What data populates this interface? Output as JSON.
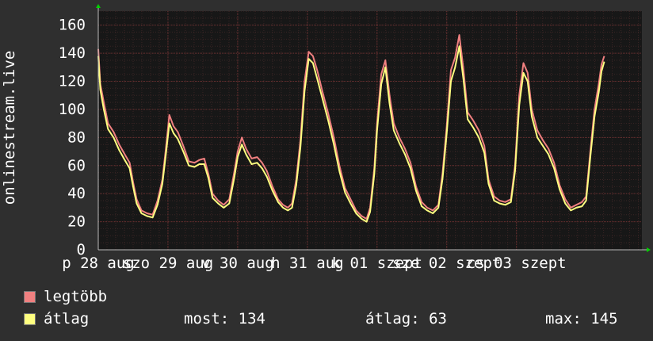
{
  "colors": {
    "background": "#2f2f2f",
    "plot_background": "#171717",
    "grid_minor": "#3a2525",
    "grid_major": "#6b3030",
    "max_series": "#f08080",
    "avg_series": "#ffff80",
    "axis_arrow": "#00d000",
    "text": "#ffffff"
  },
  "y_axis_title": "onlinestream.live",
  "legend": {
    "max_label": "legtöbb",
    "avg_label": "átlag"
  },
  "stats": {
    "current": "most: 134",
    "average": "átlag: 63",
    "maximum": "max: 145"
  },
  "chart_data": {
    "type": "line",
    "title": "",
    "ylabel": "onlinestream.live",
    "ylim": [
      0,
      170
    ],
    "yticks": [
      0,
      20,
      40,
      60,
      80,
      100,
      120,
      140,
      160
    ],
    "x": [
      "p 28 aug",
      "szo 29 aug",
      "v 30 aug",
      "h 31 aug",
      "k 01 szept",
      "sze 02 szept",
      "cs 03 szept"
    ],
    "xlim": [
      0,
      7.8
    ],
    "x_tick_labels": [
      {
        "at": 0,
        "label": "p 28 aug"
      },
      {
        "at": 1,
        "label": "szo 29 aug"
      },
      {
        "at": 2,
        "label": "v 30 aug"
      },
      {
        "at": 3,
        "label": "h 31 aug"
      },
      {
        "at": 4,
        "label": "k 01 szept"
      },
      {
        "at": 5,
        "label": "sze 02 szept"
      },
      {
        "at": 6,
        "label": "cs 03 szept"
      }
    ],
    "grid": true,
    "legend_position": "bottom-left",
    "series": [
      {
        "name": "legtöbb",
        "color": "#f08080",
        "points": [
          [
            0.0,
            143
          ],
          [
            0.03,
            118
          ],
          [
            0.08,
            105
          ],
          [
            0.14,
            90
          ],
          [
            0.22,
            84
          ],
          [
            0.3,
            75
          ],
          [
            0.38,
            68
          ],
          [
            0.45,
            62
          ],
          [
            0.5,
            48
          ],
          [
            0.55,
            36
          ],
          [
            0.62,
            28
          ],
          [
            0.7,
            26
          ],
          [
            0.78,
            25
          ],
          [
            0.85,
            35
          ],
          [
            0.92,
            50
          ],
          [
            0.97,
            72
          ],
          [
            1.02,
            96
          ],
          [
            1.08,
            88
          ],
          [
            1.14,
            84
          ],
          [
            1.22,
            74
          ],
          [
            1.3,
            63
          ],
          [
            1.38,
            62
          ],
          [
            1.45,
            64
          ],
          [
            1.52,
            65
          ],
          [
            1.58,
            54
          ],
          [
            1.64,
            40
          ],
          [
            1.72,
            35
          ],
          [
            1.8,
            32
          ],
          [
            1.88,
            36
          ],
          [
            1.95,
            55
          ],
          [
            2.0,
            70
          ],
          [
            2.06,
            80
          ],
          [
            2.12,
            72
          ],
          [
            2.2,
            65
          ],
          [
            2.28,
            66
          ],
          [
            2.35,
            62
          ],
          [
            2.42,
            56
          ],
          [
            2.5,
            45
          ],
          [
            2.58,
            36
          ],
          [
            2.65,
            32
          ],
          [
            2.72,
            30
          ],
          [
            2.78,
            33
          ],
          [
            2.84,
            50
          ],
          [
            2.9,
            78
          ],
          [
            2.96,
            120
          ],
          [
            3.02,
            141
          ],
          [
            3.08,
            138
          ],
          [
            3.14,
            128
          ],
          [
            3.22,
            112
          ],
          [
            3.3,
            97
          ],
          [
            3.38,
            80
          ],
          [
            3.46,
            60
          ],
          [
            3.54,
            44
          ],
          [
            3.62,
            36
          ],
          [
            3.7,
            28
          ],
          [
            3.78,
            24
          ],
          [
            3.85,
            22
          ],
          [
            3.9,
            30
          ],
          [
            3.96,
            58
          ],
          [
            4.0,
            90
          ],
          [
            4.06,
            125
          ],
          [
            4.12,
            135
          ],
          [
            4.18,
            110
          ],
          [
            4.24,
            90
          ],
          [
            4.32,
            80
          ],
          [
            4.4,
            72
          ],
          [
            4.48,
            62
          ],
          [
            4.56,
            45
          ],
          [
            4.64,
            34
          ],
          [
            4.72,
            30
          ],
          [
            4.8,
            28
          ],
          [
            4.88,
            32
          ],
          [
            4.94,
            55
          ],
          [
            5.0,
            88
          ],
          [
            5.06,
            128
          ],
          [
            5.12,
            137
          ],
          [
            5.18,
            153
          ],
          [
            5.24,
            128
          ],
          [
            5.3,
            98
          ],
          [
            5.38,
            92
          ],
          [
            5.46,
            85
          ],
          [
            5.54,
            74
          ],
          [
            5.6,
            50
          ],
          [
            5.68,
            38
          ],
          [
            5.76,
            35
          ],
          [
            5.84,
            34
          ],
          [
            5.92,
            36
          ],
          [
            5.98,
            60
          ],
          [
            6.04,
            110
          ],
          [
            6.1,
            133
          ],
          [
            6.16,
            126
          ],
          [
            6.22,
            100
          ],
          [
            6.3,
            85
          ],
          [
            6.38,
            78
          ],
          [
            6.46,
            72
          ],
          [
            6.54,
            62
          ],
          [
            6.62,
            46
          ],
          [
            6.7,
            36
          ],
          [
            6.78,
            30
          ],
          [
            6.86,
            32
          ],
          [
            6.94,
            34
          ],
          [
            7.0,
            38
          ],
          [
            7.06,
            70
          ],
          [
            7.12,
            100
          ],
          [
            7.18,
            118
          ],
          [
            7.22,
            132
          ],
          [
            7.26,
            138
          ]
        ]
      },
      {
        "name": "átlag",
        "color": "#ffff80",
        "points": [
          [
            0.0,
            138
          ],
          [
            0.03,
            114
          ],
          [
            0.08,
            100
          ],
          [
            0.14,
            86
          ],
          [
            0.22,
            80
          ],
          [
            0.3,
            71
          ],
          [
            0.38,
            64
          ],
          [
            0.45,
            58
          ],
          [
            0.5,
            45
          ],
          [
            0.55,
            33
          ],
          [
            0.62,
            26
          ],
          [
            0.7,
            24
          ],
          [
            0.78,
            23
          ],
          [
            0.85,
            32
          ],
          [
            0.92,
            47
          ],
          [
            0.97,
            68
          ],
          [
            1.02,
            90
          ],
          [
            1.08,
            83
          ],
          [
            1.14,
            79
          ],
          [
            1.22,
            70
          ],
          [
            1.3,
            60
          ],
          [
            1.38,
            59
          ],
          [
            1.45,
            61
          ],
          [
            1.52,
            61
          ],
          [
            1.58,
            51
          ],
          [
            1.64,
            37
          ],
          [
            1.72,
            33
          ],
          [
            1.8,
            30
          ],
          [
            1.88,
            33
          ],
          [
            1.95,
            51
          ],
          [
            2.0,
            66
          ],
          [
            2.06,
            75
          ],
          [
            2.12,
            68
          ],
          [
            2.2,
            61
          ],
          [
            2.28,
            62
          ],
          [
            2.35,
            58
          ],
          [
            2.42,
            52
          ],
          [
            2.5,
            42
          ],
          [
            2.58,
            34
          ],
          [
            2.65,
            30
          ],
          [
            2.72,
            28
          ],
          [
            2.78,
            30
          ],
          [
            2.84,
            46
          ],
          [
            2.9,
            73
          ],
          [
            2.96,
            113
          ],
          [
            3.02,
            136
          ],
          [
            3.08,
            133
          ],
          [
            3.14,
            122
          ],
          [
            3.22,
            107
          ],
          [
            3.3,
            92
          ],
          [
            3.38,
            75
          ],
          [
            3.46,
            56
          ],
          [
            3.54,
            41
          ],
          [
            3.62,
            33
          ],
          [
            3.7,
            26
          ],
          [
            3.78,
            22
          ],
          [
            3.85,
            20
          ],
          [
            3.9,
            27
          ],
          [
            3.96,
            54
          ],
          [
            4.0,
            85
          ],
          [
            4.06,
            118
          ],
          [
            4.12,
            130
          ],
          [
            4.18,
            104
          ],
          [
            4.24,
            85
          ],
          [
            4.32,
            76
          ],
          [
            4.4,
            68
          ],
          [
            4.48,
            58
          ],
          [
            4.56,
            42
          ],
          [
            4.64,
            31
          ],
          [
            4.72,
            28
          ],
          [
            4.8,
            26
          ],
          [
            4.88,
            30
          ],
          [
            4.94,
            51
          ],
          [
            5.0,
            83
          ],
          [
            5.06,
            120
          ],
          [
            5.12,
            130
          ],
          [
            5.18,
            145
          ],
          [
            5.24,
            121
          ],
          [
            5.3,
            93
          ],
          [
            5.38,
            87
          ],
          [
            5.46,
            80
          ],
          [
            5.54,
            69
          ],
          [
            5.6,
            47
          ],
          [
            5.68,
            35
          ],
          [
            5.76,
            33
          ],
          [
            5.84,
            32
          ],
          [
            5.92,
            34
          ],
          [
            5.98,
            56
          ],
          [
            6.04,
            103
          ],
          [
            6.1,
            126
          ],
          [
            6.16,
            120
          ],
          [
            6.22,
            95
          ],
          [
            6.3,
            80
          ],
          [
            6.38,
            74
          ],
          [
            6.46,
            68
          ],
          [
            6.54,
            58
          ],
          [
            6.62,
            43
          ],
          [
            6.7,
            33
          ],
          [
            6.78,
            28
          ],
          [
            6.86,
            30
          ],
          [
            6.94,
            31
          ],
          [
            7.0,
            35
          ],
          [
            7.06,
            66
          ],
          [
            7.12,
            95
          ],
          [
            7.18,
            112
          ],
          [
            7.22,
            127
          ],
          [
            7.26,
            134
          ]
        ]
      }
    ]
  }
}
